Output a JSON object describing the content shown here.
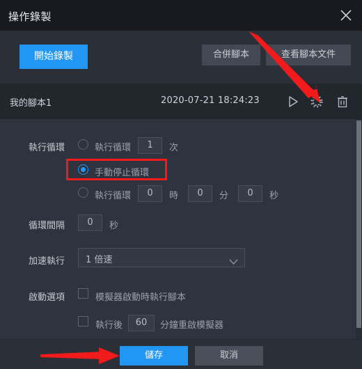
{
  "window": {
    "title": "操作錄製",
    "close_icon": "close-icon"
  },
  "toolbar": {
    "record_label": "開始錄製",
    "merge_label": "合併腳本",
    "view_files_label": "查看腳本文件"
  },
  "script_row": {
    "name": "我的腳本1",
    "timestamp": "2020-07-21 18:24:23",
    "play_icon": "play-icon",
    "settings_icon": "gear-icon",
    "delete_icon": "trash-icon"
  },
  "settings": {
    "loop": {
      "label": "執行循環",
      "option_count": {
        "prefix": "執行循環",
        "value": "1",
        "suffix": "次",
        "selected": false
      },
      "option_manual": {
        "label": "手動停止循環",
        "selected": true,
        "highlighted": true
      },
      "option_duration": {
        "prefix": "執行循環",
        "hours": "0",
        "hours_unit": "時",
        "minutes": "0",
        "minutes_unit": "分",
        "seconds": "0",
        "seconds_unit": "秒",
        "selected": false
      }
    },
    "interval": {
      "label": "循環間隔",
      "value": "0",
      "unit": "秒"
    },
    "speed": {
      "label": "加速執行",
      "selected": "1 倍速",
      "options": [
        "1 倍速"
      ]
    },
    "startup": {
      "label": "啟動選項",
      "run_on_start": {
        "label": "模擬器啟動時執行腳本",
        "checked": false
      },
      "restart_after": {
        "prefix": "執行後",
        "value": "60",
        "suffix": "分鐘重啟模擬器",
        "checked": false
      }
    }
  },
  "footer": {
    "save_label": "儲存",
    "cancel_label": "取消"
  },
  "colors": {
    "accent": "#2196f3",
    "annotation": "#f21b1b",
    "panel_bg": "#2e333d",
    "titlebar_bg": "#181a1f"
  }
}
